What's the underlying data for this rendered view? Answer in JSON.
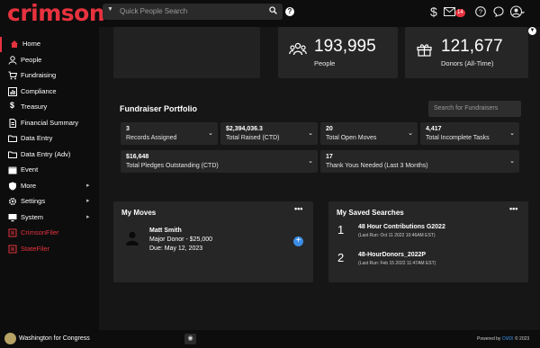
{
  "app": {
    "logo": "crimson",
    "accent": "#e8323f",
    "link_color": "#3a8ee6"
  },
  "header": {
    "search_placeholder": "Quick People Search",
    "help_label": "?",
    "icons": [
      "dollar-icon",
      "mail-icon",
      "help-circle-icon",
      "chat-icon",
      "user-icon"
    ],
    "mail_badge": "14"
  },
  "sidebar": {
    "items": [
      {
        "label": "Home",
        "icon": "home-icon",
        "active": true
      },
      {
        "label": "People",
        "icon": "person-icon"
      },
      {
        "label": "Fundraising",
        "icon": "cart-icon"
      },
      {
        "label": "Compliance",
        "icon": "chart-icon"
      },
      {
        "label": "Treasury",
        "icon": "dollar-icon"
      },
      {
        "label": "Financial Summary",
        "icon": "document-icon"
      },
      {
        "label": "Data Entry",
        "icon": "folder-icon"
      },
      {
        "label": "Data Entry (Adv)",
        "icon": "folder-icon"
      },
      {
        "label": "Event",
        "icon": "calendar-icon"
      },
      {
        "label": "More",
        "icon": "shield-icon",
        "has_arrow": true
      },
      {
        "label": "Settings",
        "icon": "gear-icon",
        "has_arrow": true
      },
      {
        "label": "System",
        "icon": "monitor-icon",
        "has_arrow": true
      },
      {
        "label": "CrimsonFiler",
        "icon": "filer-icon",
        "red": true
      },
      {
        "label": "StateFiler",
        "icon": "filer-icon",
        "red": true
      }
    ]
  },
  "stats": {
    "people": {
      "value": "193,995",
      "label": "People",
      "icon": "people-group-icon"
    },
    "donors": {
      "value": "121,677",
      "label": "Donors (All-Time)",
      "icon": "gift-icon"
    }
  },
  "portfolio": {
    "title": "Fundraiser Portfolio",
    "search_placeholder": "Search for Fundraisers",
    "tiles": [
      {
        "value": "3",
        "label": "Records Assigned"
      },
      {
        "value": "$2,394,036.3",
        "label": "Total Raised (CTD)"
      },
      {
        "value": "20",
        "label": "Total Open Moves"
      },
      {
        "value": "4,417",
        "label": "Total Incomplete Tasks"
      },
      {
        "value": "$16,648",
        "label": "Total Pledges Outstanding (CTD)"
      },
      {
        "value": "17",
        "label": "Thank Yous Needed (Last 3 Months)"
      }
    ]
  },
  "my_moves": {
    "title": "My Moves",
    "more": "•••",
    "items": [
      {
        "name": "Matt Smith",
        "detail": "Major Donor - $25,000",
        "due": "Due: May 12, 2023"
      }
    ],
    "add_label": "+"
  },
  "saved_searches": {
    "title": "My Saved Searches",
    "more": "•••",
    "items": [
      {
        "index": "1",
        "name": "48 Hour Contributions G2022",
        "last_run": "(Last Run: Oct 11 2022 10:46AM EST)"
      },
      {
        "index": "2",
        "name": "48-HourDonors_2022P",
        "last_run": "(Last Run: Feb 15 2022 11:47AM EST)"
      }
    ]
  },
  "footer": {
    "org": "Washington for Congress",
    "powered_prefix": "Powered by",
    "powered_brand": "CMDI",
    "powered_suffix": "© 2023"
  }
}
